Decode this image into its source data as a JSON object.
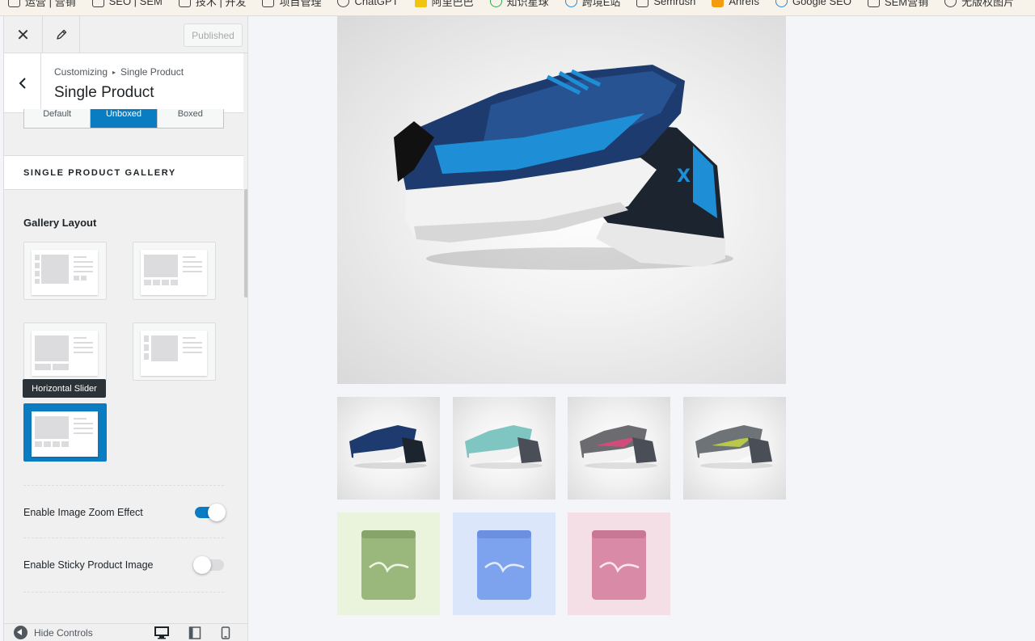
{
  "bookmarks": [
    {
      "label": "运营 | 营销",
      "icon": "folder-icon"
    },
    {
      "label": "SEO | SEM",
      "icon": "folder-icon"
    },
    {
      "label": "技术 | 开发",
      "icon": "folder-icon"
    },
    {
      "label": "项目管理",
      "icon": "folder-icon"
    },
    {
      "label": "ChatGPT",
      "icon": "chatgpt-icon"
    },
    {
      "label": "阿里巴巴",
      "icon": "alibaba-icon"
    },
    {
      "label": "知识星球",
      "icon": "planet-icon"
    },
    {
      "label": "跨境E站",
      "icon": "e-icon"
    },
    {
      "label": "Semrush",
      "icon": "semrush-icon"
    },
    {
      "label": "Ahrefs",
      "icon": "ahrefs-icon"
    },
    {
      "label": "Google SEO",
      "icon": "google-icon"
    },
    {
      "label": "SEM营销",
      "icon": "sem-icon"
    },
    {
      "label": "无版权图片",
      "icon": "pin-icon"
    }
  ],
  "topbar": {
    "published_label": "Published"
  },
  "section": {
    "breadcrumb_parent": "Customizing",
    "breadcrumb_child": "Single Product",
    "title": "Single Product"
  },
  "layout_tabs": [
    {
      "label": "Default",
      "active": false
    },
    {
      "label": "Unboxed",
      "active": true
    },
    {
      "label": "Boxed",
      "active": false
    }
  ],
  "gallery": {
    "header": "SINGLE PRODUCT GALLERY",
    "layout_label": "Gallery Layout",
    "tooltip": "Horizontal Slider",
    "selected_layout": "horizontal-slider"
  },
  "toggles": {
    "zoom": {
      "label": "Enable Image Zoom Effect",
      "on": true
    },
    "sticky": {
      "label": "Enable Sticky Product Image",
      "on": false
    }
  },
  "bottom": {
    "hide_controls": "Hide Controls"
  },
  "colors": {
    "accent": "#0a7cc1",
    "sidebar_bg": "#f0f0f1",
    "preview_bg": "#f3f5f8"
  }
}
